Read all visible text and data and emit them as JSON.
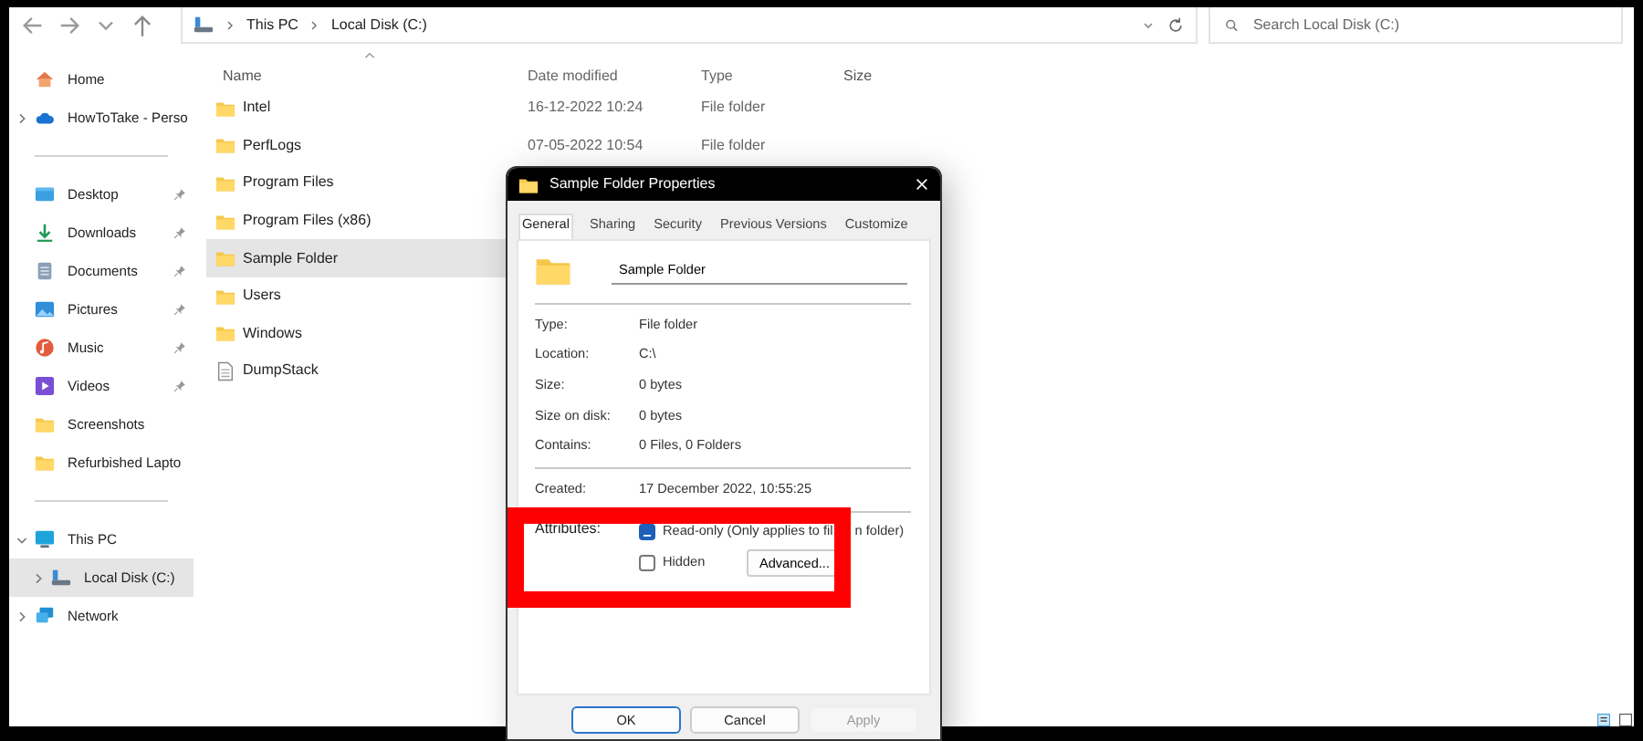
{
  "toolbar": {
    "breadcrumbs": [
      "This PC",
      "Local Disk (C:)"
    ],
    "search": {
      "placeholder": "Search Local Disk (C:)"
    }
  },
  "sidebar": {
    "groups": [
      [
        {
          "label": "Home",
          "kind": "home",
          "pinned": false,
          "selected": false
        },
        {
          "label": "HowToTake - Perso",
          "kind": "cloud",
          "pinned": false,
          "expanded": false,
          "selected": false
        }
      ],
      [
        {
          "label": "Desktop",
          "kind": "desktop",
          "pinned": true,
          "selected": false
        },
        {
          "label": "Downloads",
          "kind": "downloads",
          "pinned": true,
          "selected": false
        },
        {
          "label": "Documents",
          "kind": "documents",
          "pinned": true,
          "selected": false
        },
        {
          "label": "Pictures",
          "kind": "pictures",
          "pinned": true,
          "selected": false
        },
        {
          "label": "Music",
          "kind": "music",
          "pinned": true,
          "selected": false
        },
        {
          "label": "Videos",
          "kind": "videos",
          "pinned": true,
          "selected": false
        },
        {
          "label": "Screenshots",
          "kind": "folder",
          "pinned": false,
          "selected": false
        },
        {
          "label": "Refurbished Lapto",
          "kind": "folder",
          "pinned": false,
          "selected": false
        }
      ],
      [
        {
          "label": "This PC",
          "kind": "pc",
          "pinned": false,
          "expanded": true,
          "selected": false,
          "children": [
            {
              "label": "Local Disk (C:)",
              "kind": "drive",
              "pinned": false,
              "expanded": false,
              "selected": true
            }
          ]
        },
        {
          "label": "Network",
          "kind": "network",
          "pinned": false,
          "expanded": false,
          "selected": false
        }
      ]
    ]
  },
  "file_list": {
    "columns": [
      "Name",
      "Date modified",
      "Type",
      "Size"
    ],
    "rows": [
      {
        "name": "Intel",
        "kind": "folder",
        "date": "16-12-2022 10:24",
        "type": "File folder",
        "selected": false
      },
      {
        "name": "PerfLogs",
        "kind": "folder",
        "date": "07-05-2022 10:54",
        "type": "File folder",
        "selected": false
      },
      {
        "name": "Program Files",
        "kind": "folder",
        "selected": false
      },
      {
        "name": "Program Files (x86)",
        "kind": "folder",
        "selected": false
      },
      {
        "name": "Sample Folder",
        "kind": "folder",
        "selected": true
      },
      {
        "name": "Users",
        "kind": "folder",
        "selected": false
      },
      {
        "name": "Windows",
        "kind": "folder",
        "selected": false
      },
      {
        "name": "DumpStack",
        "kind": "file",
        "selected": false
      }
    ]
  },
  "dialog": {
    "title": "Sample Folder Properties",
    "tabs": [
      {
        "label": "General",
        "selected": true
      },
      {
        "label": "Sharing",
        "selected": false
      },
      {
        "label": "Security",
        "selected": false
      },
      {
        "label": "Previous Versions",
        "selected": false
      },
      {
        "label": "Customize",
        "selected": false
      }
    ],
    "name_field": {
      "value": "Sample Folder"
    },
    "properties": [
      {
        "label": "Type:",
        "value": "File folder"
      },
      {
        "label": "Location:",
        "value": "C:\\"
      },
      {
        "label": "Size:",
        "value": "0 bytes"
      },
      {
        "label": "Size on disk:",
        "value": "0 bytes"
      },
      {
        "label": "Contains:",
        "value": "0 Files, 0 Folders"
      }
    ],
    "created": {
      "label": "Created:",
      "value": "17 December 2022, 10:55:25"
    },
    "attributes": {
      "label": "Attributes:",
      "options": [
        {
          "parts": [
            "Read-only (Only applies to fil",
            "n folder)"
          ],
          "indeterminate": true
        },
        {
          "parts": [
            "Hidden"
          ],
          "indeterminate": false
        }
      ],
      "advanced_button": "Advanced..."
    },
    "buttons": [
      {
        "label": "OK",
        "default": true,
        "disabled": false
      },
      {
        "label": "Cancel",
        "default": false,
        "disabled": false
      },
      {
        "label": "Apply",
        "default": false,
        "disabled": true
      }
    ]
  }
}
